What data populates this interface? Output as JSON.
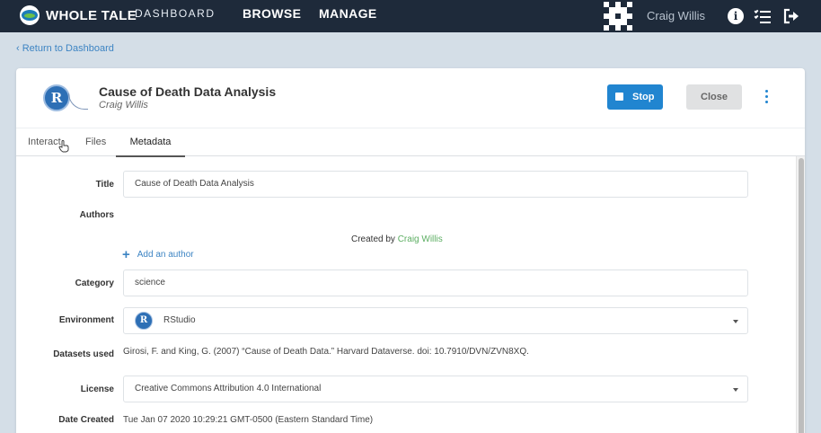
{
  "topnav": {
    "brand": "WHOLE TALE",
    "dashboard": "DASHBOARD",
    "browse": "BROWSE",
    "manage": "MANAGE",
    "user_name": "Craig Willis",
    "icons": [
      "info-icon",
      "tasks-icon",
      "logout-icon"
    ]
  },
  "return_link": "Return to Dashboard",
  "tale": {
    "title": "Cause of Death Data Analysis",
    "author": "Craig Willis",
    "stop_label": "Stop",
    "close_label": "Close"
  },
  "tabs": [
    {
      "label": "Interact",
      "active": false
    },
    {
      "label": "Files",
      "active": false
    },
    {
      "label": "Metadata",
      "active": true
    }
  ],
  "metadata": {
    "title_label": "Title",
    "title_value": "Cause of Death Data Analysis",
    "authors_label": "Authors",
    "created_by_prefix": "Created by",
    "created_by_name": "Craig Willis",
    "add_author": "Add an author",
    "category_label": "Category",
    "category_value": "science",
    "environment_label": "Environment",
    "environment_value": "RStudio",
    "datasets_label": "Datasets used",
    "datasets_value": "Girosi, F. and King, G. (2007) “Cause of Death Data.” Harvard Dataverse. doi: 10.7910/DVN/ZVN8XQ.",
    "license_label": "License",
    "license_value": "Creative Commons Attribution 4.0 International",
    "date_created_label": "Date Created",
    "date_created_value": "Tue Jan 07 2020 10:29:21 GMT-0500 (Eastern Standard Time)"
  },
  "colors": {
    "nav_bg": "#1e2a3a",
    "page_bg": "#d4dee7",
    "primary": "#2185d0",
    "link": "#3d84c3",
    "author_link": "#5cae62"
  }
}
